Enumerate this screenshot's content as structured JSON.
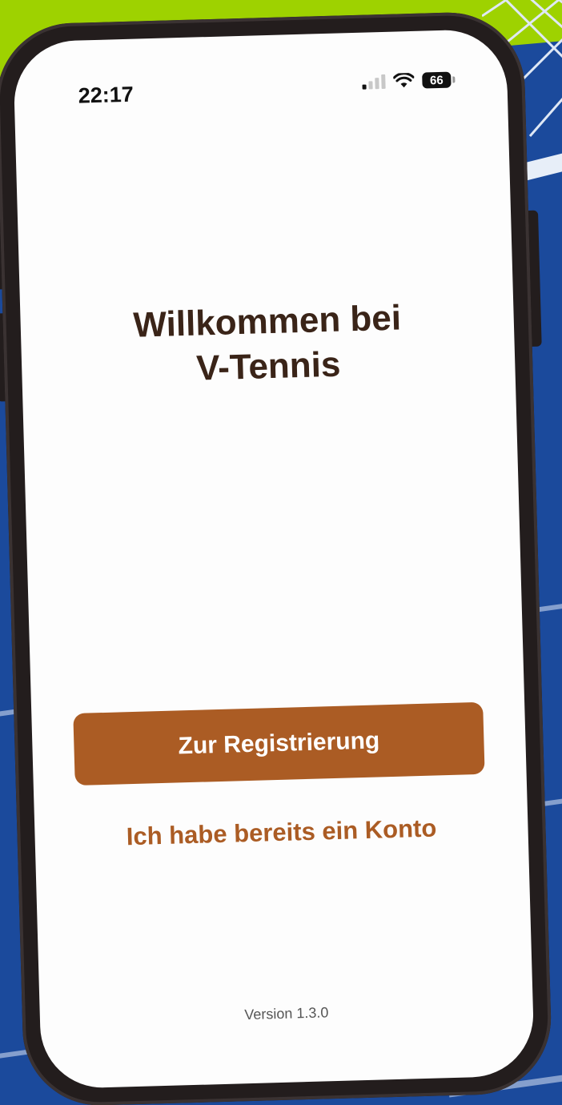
{
  "status_bar": {
    "time": "22:17",
    "battery": "66"
  },
  "welcome": {
    "line1": "Willkommen bei",
    "line2": "V-Tennis"
  },
  "actions": {
    "register_label": "Zur Registrierung",
    "login_label": "Ich habe bereits ein Konto"
  },
  "footer": {
    "version": "Version 1.3.0"
  },
  "colors": {
    "accent": "#ab5c24",
    "title": "#3a2418",
    "background_court": "#1b4a9c",
    "background_green": "#9ed200"
  }
}
